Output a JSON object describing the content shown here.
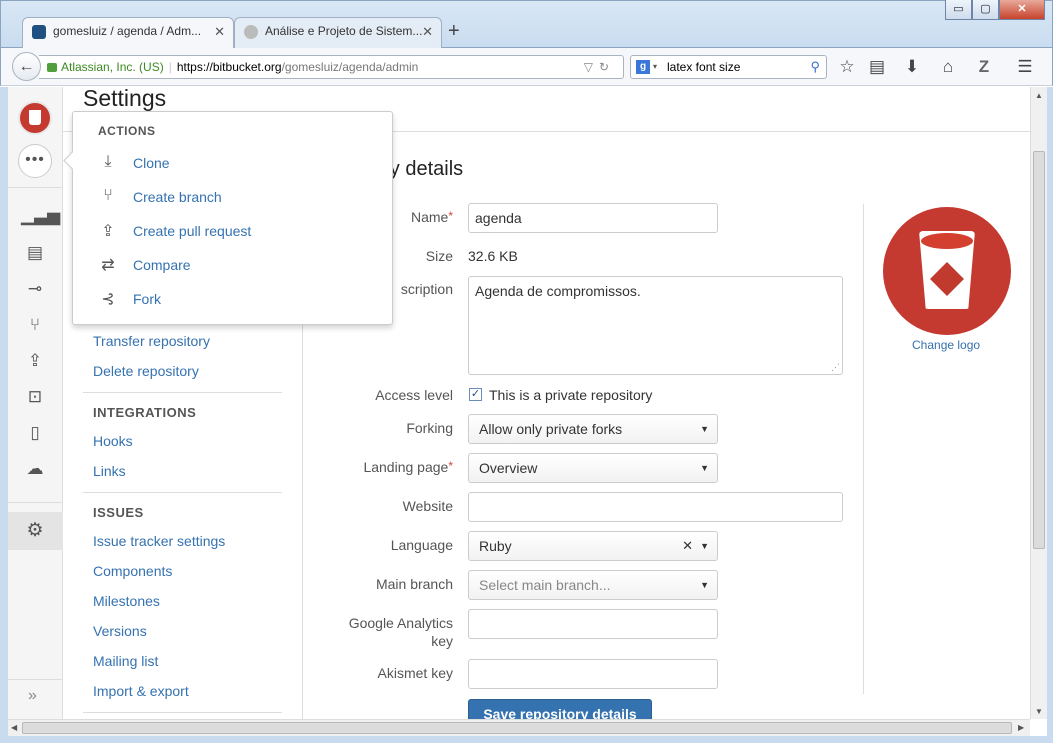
{
  "browser": {
    "tabs": [
      {
        "title": "gomesluiz / agenda / Adm...",
        "favicon_color": "#205081"
      },
      {
        "title": "Análise e Projeto de Sistem...",
        "favicon_color": "#888888"
      }
    ],
    "window_controls": {
      "minimize": "▭",
      "maximize": "▢",
      "close": "✕"
    },
    "identity": "Atlassian, Inc. (US)",
    "url_host": "https://bitbucket.org",
    "url_path": "/gomesluiz/agenda/admin",
    "search_engine_letter": "g",
    "search_text": "latex font size",
    "toolbar_icons": [
      "star-icon",
      "reading-list-icon",
      "download-icon",
      "home-icon",
      "zotero-icon",
      "menu-icon"
    ]
  },
  "leftnav": {
    "icons": [
      "overview-icon",
      "source-icon",
      "commits-icon",
      "branches-icon",
      "pull-requests-icon",
      "issues-icon",
      "wiki-icon",
      "downloads-icon"
    ],
    "settings_icon": "gear-icon",
    "expand_label": "»"
  },
  "page": {
    "title": "Settings",
    "section_title": "ory details"
  },
  "subnav": {
    "transfer": "Transfer repository",
    "delete": "Delete repository",
    "integrations_head": "INTEGRATIONS",
    "hooks": "Hooks",
    "links": "Links",
    "issues_head": "ISSUES",
    "issue_tracker": "Issue tracker settings",
    "components": "Components",
    "milestones": "Milestones",
    "versions": "Versions",
    "mailing_list": "Mailing list",
    "import_export": "Import & export"
  },
  "actions_menu": {
    "heading": "ACTIONS",
    "items": [
      {
        "label": "Clone",
        "icon": "⤓"
      },
      {
        "label": "Create branch",
        "icon": "⑂"
      },
      {
        "label": "Create pull request",
        "icon": "⇪"
      },
      {
        "label": "Compare",
        "icon": "⇄"
      },
      {
        "label": "Fork",
        "icon": "⊰"
      }
    ]
  },
  "form": {
    "name_label": "Name",
    "name_value": "agenda",
    "size_label": "Size",
    "size_value": "32.6 KB",
    "description_label": "scription",
    "description_value": "Agenda  de compromissos.",
    "access_label": "Access level",
    "access_checked": true,
    "access_text": "This is a private repository",
    "forking_label": "Forking",
    "forking_value": "Allow only private forks",
    "landing_label": "Landing page",
    "landing_value": "Overview",
    "website_label": "Website",
    "website_value": "",
    "language_label": "Language",
    "language_value": "Ruby",
    "main_branch_label": "Main branch",
    "main_branch_placeholder": "Select main branch...",
    "ga_label_1": "Google Analytics",
    "ga_label_2": "key",
    "ga_value": "",
    "akismet_label": "Akismet key",
    "akismet_value": "",
    "save_label": "Save repository details",
    "change_logo": "Change logo"
  },
  "colors": {
    "link": "#3572b0",
    "primary_button": "#3572b0",
    "required": "#d04437",
    "logo_red": "#c53a30"
  }
}
